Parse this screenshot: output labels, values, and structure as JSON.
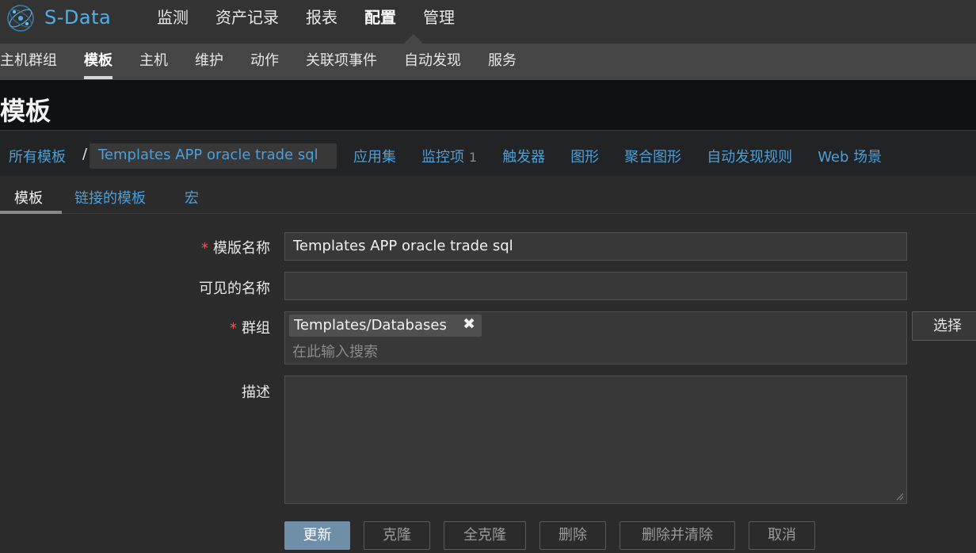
{
  "app": {
    "brand": "S-Data"
  },
  "main_nav": [
    {
      "label": "监测"
    },
    {
      "label": "资产记录"
    },
    {
      "label": "报表"
    },
    {
      "label": "配置"
    },
    {
      "label": "管理"
    }
  ],
  "sub_nav": [
    {
      "label": "主机群组"
    },
    {
      "label": "模板"
    },
    {
      "label": "主机"
    },
    {
      "label": "维护"
    },
    {
      "label": "动作"
    },
    {
      "label": "关联项事件"
    },
    {
      "label": "自动发现"
    },
    {
      "label": "服务"
    }
  ],
  "page": {
    "title": "模板"
  },
  "breadcrumb": {
    "all": "所有模板",
    "separator": "/",
    "current": "Templates APP oracle trade sql",
    "links": [
      {
        "label": "应用集",
        "count": ""
      },
      {
        "label": "监控项",
        "count": "1"
      },
      {
        "label": "触发器",
        "count": ""
      },
      {
        "label": "图形",
        "count": ""
      },
      {
        "label": "聚合图形",
        "count": ""
      },
      {
        "label": "自动发现规则",
        "count": ""
      },
      {
        "label": "Web 场景",
        "count": ""
      }
    ]
  },
  "tabs": [
    {
      "label": "模板"
    },
    {
      "label": "链接的模板"
    },
    {
      "label": "宏"
    }
  ],
  "form": {
    "required_mark": "*",
    "template_name_label": "模版名称",
    "template_name_value": "Templates APP oracle trade sql",
    "visible_name_label": "可见的名称",
    "visible_name_value": "",
    "groups_label": "群组",
    "group_tag": "Templates/Databases",
    "group_tag_close": "✖",
    "group_search_placeholder": "在此输入搜索",
    "select_button": "选择",
    "description_label": "描述",
    "description_value": ""
  },
  "actions": {
    "update": "更新",
    "clone": "克隆",
    "full_clone": "全克隆",
    "delete": "删除",
    "delete_and_clear": "删除并清除",
    "cancel": "取消"
  },
  "colors": {
    "link": "#4b9fd8",
    "primary_button": "#6f8fa8",
    "required": "#e45959"
  }
}
